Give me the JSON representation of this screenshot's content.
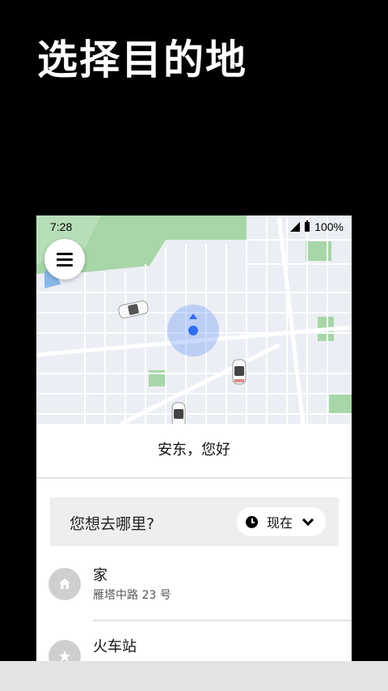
{
  "headline": "选择目的地",
  "status": {
    "time": "7:28",
    "battery": "100%"
  },
  "greeting": "安东，您好",
  "search": {
    "prompt": "您想去哪里?",
    "time_option": "现在"
  },
  "places": [
    {
      "title": "家",
      "subtitle": "雁塔中路 23 号",
      "icon": "home-icon"
    },
    {
      "title": "火车站",
      "subtitle": "",
      "icon": "star-icon"
    }
  ],
  "colors": {
    "map_bg": "#eceef5",
    "park": "#a7d6a8",
    "location_blue": "#2f6ff2"
  }
}
